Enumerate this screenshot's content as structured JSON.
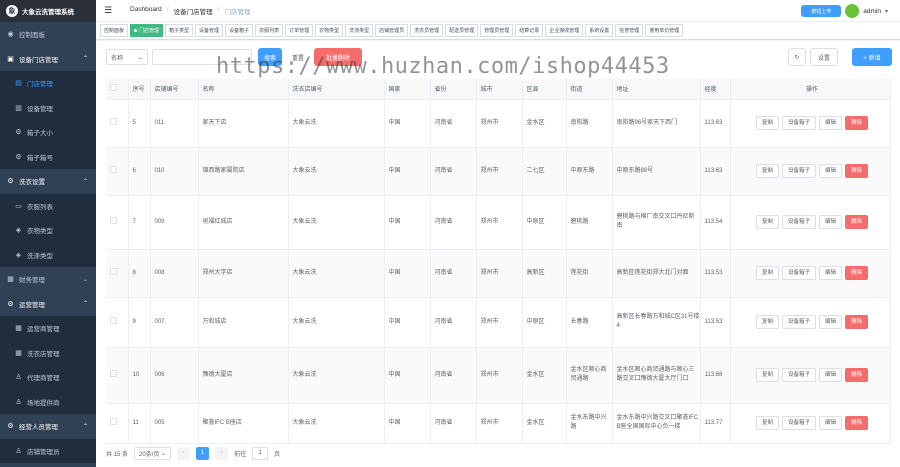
{
  "app": {
    "title": "大象云洗管理系统",
    "logo_glyph": "象"
  },
  "sidebar": {
    "items": [
      {
        "label": "控制面板",
        "icon": "dashboard-icon",
        "glyph": "◉",
        "type": "top"
      },
      {
        "label": "设备门店管理",
        "icon": "device-icon",
        "glyph": "▣",
        "type": "top-open",
        "arrow": "⌃"
      },
      {
        "label": "门店管理",
        "icon": "store-icon",
        "glyph": "▤",
        "type": "sub-active"
      },
      {
        "label": "设备管理",
        "icon": "monitor-icon",
        "glyph": "▥",
        "type": "sub"
      },
      {
        "label": "箱子大小",
        "icon": "gear-icon",
        "glyph": "⚙",
        "type": "sub"
      },
      {
        "label": "箱子箱号",
        "icon": "gear-icon",
        "glyph": "⚙",
        "type": "sub"
      },
      {
        "label": "洗衣设置",
        "icon": "settings-icon",
        "glyph": "⚙",
        "type": "top-open",
        "arrow": "⌃"
      },
      {
        "label": "衣服列表",
        "icon": "list-icon",
        "glyph": "▭",
        "type": "sub"
      },
      {
        "label": "衣物类型",
        "icon": "tag-icon",
        "glyph": "◈",
        "type": "sub"
      },
      {
        "label": "洗涤类型",
        "icon": "tag-icon",
        "glyph": "◈",
        "type": "sub"
      },
      {
        "label": "财务管理",
        "icon": "finance-icon",
        "glyph": "▦",
        "type": "top",
        "arrow": "⌄"
      },
      {
        "label": "运营管理",
        "icon": "operation-icon",
        "glyph": "⚙",
        "type": "top-open",
        "arrow": "⌃"
      },
      {
        "label": "运营商管理",
        "icon": "table-icon",
        "glyph": "▦",
        "type": "sub"
      },
      {
        "label": "洗衣店管理",
        "icon": "table-icon",
        "glyph": "▦",
        "type": "sub"
      },
      {
        "label": "代理商管理",
        "icon": "user-icon",
        "glyph": "♙",
        "type": "sub"
      },
      {
        "label": "场地提供商",
        "icon": "user-icon",
        "glyph": "♙",
        "type": "sub"
      },
      {
        "label": "经营人员管理",
        "icon": "settings-icon",
        "glyph": "⚙",
        "type": "top-open",
        "arrow": "⌃"
      },
      {
        "label": "店铺管理员",
        "icon": "user-icon",
        "glyph": "♙",
        "type": "sub"
      }
    ]
  },
  "header": {
    "breadcrumbs": [
      "Dashboard",
      "设备门店管理",
      "门店管理"
    ],
    "app_badge": "按钮上传",
    "username": "admin",
    "dropdown_glyph": "▾"
  },
  "tags": [
    {
      "label": "控制面板",
      "active": false
    },
    {
      "label": "门店管理",
      "active": true
    },
    {
      "label": "箱子类型",
      "active": false
    },
    {
      "label": "设备管理",
      "active": false
    },
    {
      "label": "设备箱子",
      "active": false
    },
    {
      "label": "衣服列表",
      "active": false
    },
    {
      "label": "订单管理",
      "active": false
    },
    {
      "label": "衣物类型",
      "active": false
    },
    {
      "label": "洗涤类型",
      "active": false
    },
    {
      "label": "店铺管理员",
      "active": false
    },
    {
      "label": "洗衣员管理",
      "active": false
    },
    {
      "label": "配送员管理",
      "active": false
    },
    {
      "label": "管理员管理",
      "active": false
    },
    {
      "label": "结算记录",
      "active": false
    },
    {
      "label": "企业接收管理",
      "active": false
    },
    {
      "label": "系统设置",
      "active": false
    },
    {
      "label": "信誉管理",
      "active": false
    },
    {
      "label": "使用单价管理",
      "active": false
    }
  ],
  "toolbar": {
    "search_field_label": "名称",
    "search_placeholder": "",
    "search_btn": "搜索",
    "reset_btn": "重置",
    "batch_delete_btn": "批量删除",
    "refresh_glyph": "↻",
    "settings_btn": "设置",
    "add_btn": "+ 新增"
  },
  "watermark": "https://www.huzhan.com/ishop44453",
  "table": {
    "headers": [
      "",
      "序号",
      "店铺编号",
      "名称",
      "洗衣店编号",
      "国家",
      "省份",
      "城市",
      "区县",
      "街道",
      "地址",
      "经度",
      "操作"
    ],
    "rows": [
      {
        "idx": "5",
        "code": "011",
        "name": "家天下店",
        "laundry": "大象云洗",
        "country": "中国",
        "province": "河南省",
        "city": "郑州市",
        "district": "金水区",
        "street": "南阳路",
        "address": "南阳路96号家天下西门",
        "lng": "113.63"
      },
      {
        "idx": "6",
        "code": "010",
        "name": "锦西路家属院店",
        "laundry": "大象云洗",
        "country": "中国",
        "province": "河南省",
        "city": "郑州市",
        "district": "二七区",
        "street": "中原东路",
        "address": "中原东路88号",
        "lng": "113.63"
      },
      {
        "idx": "7",
        "code": "009",
        "name": "祝福红城店",
        "laundry": "大象云洗",
        "country": "中国",
        "province": "河南省",
        "city": "郑州市",
        "district": "中原区",
        "street": "碧桃路",
        "address": "碧桃路与棉厂南交叉口丹尼斯南",
        "lng": "113.54"
      },
      {
        "idx": "8",
        "code": "008",
        "name": "郑州大学店",
        "laundry": "大象云洗",
        "country": "中国",
        "province": "河南省",
        "city": "郑州市",
        "district": "高新区",
        "street": "莲花街",
        "address": "高新区莲花街郑大北门对面",
        "lng": "113.53"
      },
      {
        "idx": "9",
        "code": "007",
        "name": "万和城店",
        "laundry": "大象云洗",
        "country": "中国",
        "province": "河南省",
        "city": "郑州市",
        "district": "中原区",
        "street": "长春路",
        "address": "高新区长春路万和城C区31号楼4",
        "lng": "113.53"
      },
      {
        "idx": "10",
        "code": "006",
        "name": "豫德大厦店",
        "laundry": "大象云洗",
        "country": "中国",
        "province": "河南省",
        "city": "郑州市",
        "district": "金水区",
        "street": "金水区顺心商贸通路",
        "address": "金水区顺心商贸通路与顺心三路交叉口豫德大厦大厅门口",
        "lng": "113.68"
      },
      {
        "idx": "11",
        "code": "005",
        "name": "聚荟IFC B座店",
        "laundry": "大象云洗",
        "country": "中国",
        "province": "河南省",
        "city": "郑州市",
        "district": "金水区",
        "street": "金水东路中兴路",
        "address": "金水东路中兴路交叉口聚荟IFC B座全国国际中心负一楼",
        "lng": "113.77"
      }
    ],
    "ops": {
      "copy": "复制",
      "box": "设备箱子",
      "edit": "编辑",
      "delete": "删除"
    }
  },
  "pagination": {
    "total": "共 15 条",
    "page_size": "20条/页",
    "prev_glyph": "‹",
    "current_page": "1",
    "next_glyph": "›",
    "goto_label": "前往",
    "goto_value": "1",
    "page_suffix": "页"
  }
}
